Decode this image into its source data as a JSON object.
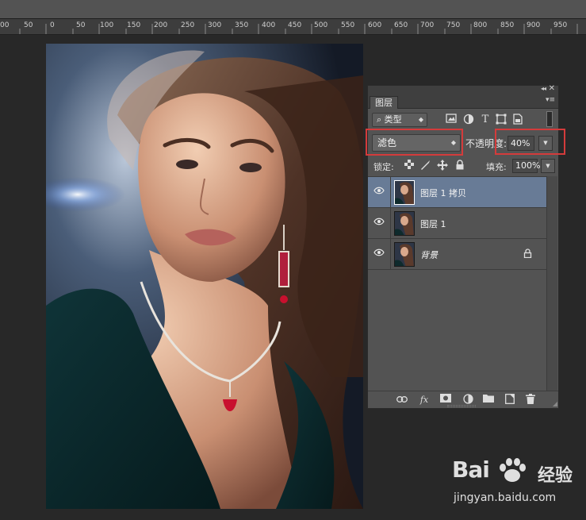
{
  "ruler": {
    "marks": [
      "00",
      "50",
      "0",
      "50",
      "100",
      "150",
      "200",
      "250",
      "300",
      "350",
      "400",
      "450",
      "500",
      "550",
      "600",
      "650",
      "700",
      "750",
      "800",
      "850",
      "900",
      "950"
    ]
  },
  "layers_panel": {
    "collapse_glyph": "◂◂",
    "close_glyph": "✕",
    "tab_label": "图层",
    "tab_menu_glyph": "▾≡",
    "filter": {
      "label": "类型",
      "search_glyph": "⌕"
    },
    "filter_icons": [
      "image-filter-icon",
      "adjustment-filter-icon",
      "type-filter-icon",
      "shape-filter-icon",
      "smart-object-filter-icon"
    ],
    "blend_mode": "滤色",
    "opacity_label": "不透明度:",
    "opacity_value": "40%",
    "lock_label": "锁定:",
    "fill_label": "填充:",
    "fill_value": "100%",
    "layers": [
      {
        "name": "图层 1 拷贝",
        "selected": true,
        "locked": false
      },
      {
        "name": "图层 1",
        "selected": false,
        "locked": false
      },
      {
        "name": "背景",
        "selected": false,
        "locked": true
      }
    ],
    "bottom_icons": [
      "link-icon",
      "fx-icon",
      "mask-icon",
      "adjustment-layer-icon",
      "group-folder-icon",
      "new-layer-icon",
      "trash-icon"
    ]
  },
  "watermark": {
    "logo": "Bai",
    "cn": "经验",
    "url": "jingyan.baidu.com"
  },
  "colors": {
    "accent_selected": "#687b96",
    "highlight_box": "#d43b3b",
    "panel_bg": "#535353"
  }
}
